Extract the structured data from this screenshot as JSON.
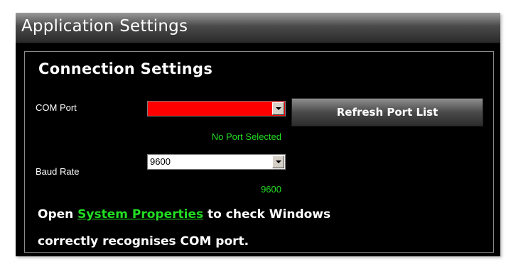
{
  "window": {
    "title": "Application Settings"
  },
  "group": {
    "title": "Connection Settings"
  },
  "com_port": {
    "label": "COM Port",
    "value": "",
    "status": "No Port Selected",
    "field_color": "#ff0000"
  },
  "refresh_button": {
    "label": "Refresh Port List"
  },
  "baud_rate": {
    "label": "Baud Rate",
    "value": "9600",
    "status": "9600"
  },
  "info": {
    "prefix": "Open ",
    "link": "System Properties",
    "suffix": " to check Windows",
    "line2": "correctly recognises COM port."
  },
  "colors": {
    "accent_green": "#22dd22",
    "background": "#000000"
  }
}
